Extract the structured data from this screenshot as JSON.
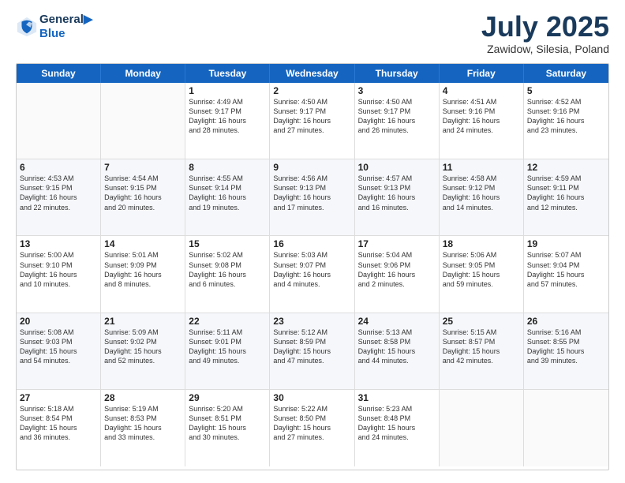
{
  "header": {
    "logo_line1": "General",
    "logo_line2": "Blue",
    "month": "July 2025",
    "location": "Zawidow, Silesia, Poland"
  },
  "days_of_week": [
    "Sunday",
    "Monday",
    "Tuesday",
    "Wednesday",
    "Thursday",
    "Friday",
    "Saturday"
  ],
  "weeks": [
    [
      {
        "day": "",
        "info": ""
      },
      {
        "day": "",
        "info": ""
      },
      {
        "day": "1",
        "info": "Sunrise: 4:49 AM\nSunset: 9:17 PM\nDaylight: 16 hours\nand 28 minutes."
      },
      {
        "day": "2",
        "info": "Sunrise: 4:50 AM\nSunset: 9:17 PM\nDaylight: 16 hours\nand 27 minutes."
      },
      {
        "day": "3",
        "info": "Sunrise: 4:50 AM\nSunset: 9:17 PM\nDaylight: 16 hours\nand 26 minutes."
      },
      {
        "day": "4",
        "info": "Sunrise: 4:51 AM\nSunset: 9:16 PM\nDaylight: 16 hours\nand 24 minutes."
      },
      {
        "day": "5",
        "info": "Sunrise: 4:52 AM\nSunset: 9:16 PM\nDaylight: 16 hours\nand 23 minutes."
      }
    ],
    [
      {
        "day": "6",
        "info": "Sunrise: 4:53 AM\nSunset: 9:15 PM\nDaylight: 16 hours\nand 22 minutes."
      },
      {
        "day": "7",
        "info": "Sunrise: 4:54 AM\nSunset: 9:15 PM\nDaylight: 16 hours\nand 20 minutes."
      },
      {
        "day": "8",
        "info": "Sunrise: 4:55 AM\nSunset: 9:14 PM\nDaylight: 16 hours\nand 19 minutes."
      },
      {
        "day": "9",
        "info": "Sunrise: 4:56 AM\nSunset: 9:13 PM\nDaylight: 16 hours\nand 17 minutes."
      },
      {
        "day": "10",
        "info": "Sunrise: 4:57 AM\nSunset: 9:13 PM\nDaylight: 16 hours\nand 16 minutes."
      },
      {
        "day": "11",
        "info": "Sunrise: 4:58 AM\nSunset: 9:12 PM\nDaylight: 16 hours\nand 14 minutes."
      },
      {
        "day": "12",
        "info": "Sunrise: 4:59 AM\nSunset: 9:11 PM\nDaylight: 16 hours\nand 12 minutes."
      }
    ],
    [
      {
        "day": "13",
        "info": "Sunrise: 5:00 AM\nSunset: 9:10 PM\nDaylight: 16 hours\nand 10 minutes."
      },
      {
        "day": "14",
        "info": "Sunrise: 5:01 AM\nSunset: 9:09 PM\nDaylight: 16 hours\nand 8 minutes."
      },
      {
        "day": "15",
        "info": "Sunrise: 5:02 AM\nSunset: 9:08 PM\nDaylight: 16 hours\nand 6 minutes."
      },
      {
        "day": "16",
        "info": "Sunrise: 5:03 AM\nSunset: 9:07 PM\nDaylight: 16 hours\nand 4 minutes."
      },
      {
        "day": "17",
        "info": "Sunrise: 5:04 AM\nSunset: 9:06 PM\nDaylight: 16 hours\nand 2 minutes."
      },
      {
        "day": "18",
        "info": "Sunrise: 5:06 AM\nSunset: 9:05 PM\nDaylight: 15 hours\nand 59 minutes."
      },
      {
        "day": "19",
        "info": "Sunrise: 5:07 AM\nSunset: 9:04 PM\nDaylight: 15 hours\nand 57 minutes."
      }
    ],
    [
      {
        "day": "20",
        "info": "Sunrise: 5:08 AM\nSunset: 9:03 PM\nDaylight: 15 hours\nand 54 minutes."
      },
      {
        "day": "21",
        "info": "Sunrise: 5:09 AM\nSunset: 9:02 PM\nDaylight: 15 hours\nand 52 minutes."
      },
      {
        "day": "22",
        "info": "Sunrise: 5:11 AM\nSunset: 9:01 PM\nDaylight: 15 hours\nand 49 minutes."
      },
      {
        "day": "23",
        "info": "Sunrise: 5:12 AM\nSunset: 8:59 PM\nDaylight: 15 hours\nand 47 minutes."
      },
      {
        "day": "24",
        "info": "Sunrise: 5:13 AM\nSunset: 8:58 PM\nDaylight: 15 hours\nand 44 minutes."
      },
      {
        "day": "25",
        "info": "Sunrise: 5:15 AM\nSunset: 8:57 PM\nDaylight: 15 hours\nand 42 minutes."
      },
      {
        "day": "26",
        "info": "Sunrise: 5:16 AM\nSunset: 8:55 PM\nDaylight: 15 hours\nand 39 minutes."
      }
    ],
    [
      {
        "day": "27",
        "info": "Sunrise: 5:18 AM\nSunset: 8:54 PM\nDaylight: 15 hours\nand 36 minutes."
      },
      {
        "day": "28",
        "info": "Sunrise: 5:19 AM\nSunset: 8:53 PM\nDaylight: 15 hours\nand 33 minutes."
      },
      {
        "day": "29",
        "info": "Sunrise: 5:20 AM\nSunset: 8:51 PM\nDaylight: 15 hours\nand 30 minutes."
      },
      {
        "day": "30",
        "info": "Sunrise: 5:22 AM\nSunset: 8:50 PM\nDaylight: 15 hours\nand 27 minutes."
      },
      {
        "day": "31",
        "info": "Sunrise: 5:23 AM\nSunset: 8:48 PM\nDaylight: 15 hours\nand 24 minutes."
      },
      {
        "day": "",
        "info": ""
      },
      {
        "day": "",
        "info": ""
      }
    ]
  ]
}
